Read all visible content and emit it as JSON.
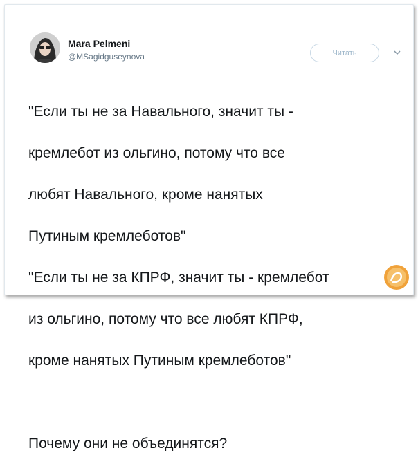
{
  "tweet": {
    "author_name": "Mara Pelmeni",
    "author_handle": "@MSagidguseynova",
    "follow_label": "Читать",
    "text_lines": [
      "\"Если ты не за Навального, значит ты -",
      "кремлебот из ольгино, потому что все",
      "любят Навального, кроме нанятых",
      "Путиным кремлеботов\"",
      "\"Если ты не за КПРФ, значит ты - кремлебот",
      "из ольгино, потому что все любят КПРФ,",
      "кроме нанятых Путиным кремлеботов\"",
      "",
      "Почему они не объединятся?"
    ]
  },
  "icons": {
    "avatar": "avatar-photo",
    "caret": "chevron-down-icon",
    "watermark": "site-watermark-logo"
  },
  "colors": {
    "name": "#14171a",
    "handle": "#657786",
    "follow_border": "#c7d7e4",
    "follow_text": "#9fb8cb",
    "watermark": "#f0a23a"
  }
}
